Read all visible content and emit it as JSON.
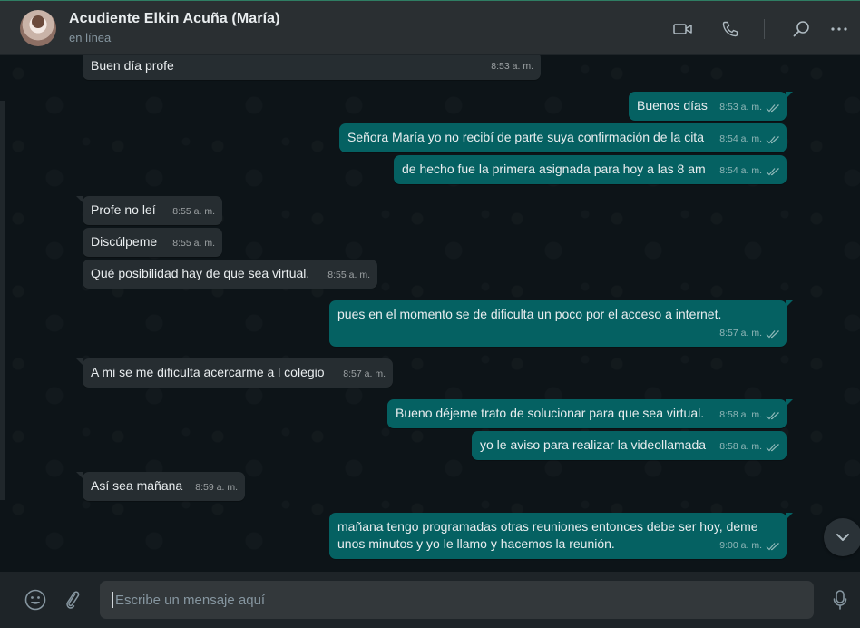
{
  "header": {
    "name": "Acudiente Elkin Acuña (María)",
    "status": "en línea"
  },
  "messages": [
    {
      "dir": "in",
      "text": "Buen día profe",
      "time": "8:53 a. m."
    },
    {
      "dir": "out",
      "text": "Buenos días",
      "time": "8:53 a. m."
    },
    {
      "dir": "out",
      "text": "Señora María yo no recibí de parte suya confirmación de la cita",
      "time": "8:54 a. m."
    },
    {
      "dir": "out",
      "text": "de hecho fue la primera asignada para hoy a las 8 am",
      "time": "8:54 a. m."
    },
    {
      "dir": "in",
      "text": "Profe no leí",
      "time": "8:55 a. m."
    },
    {
      "dir": "in",
      "text": "Discúlpeme",
      "time": "8:55 a. m."
    },
    {
      "dir": "in",
      "text": "Qué posibilidad hay de que sea virtual.",
      "time": "8:55 a. m."
    },
    {
      "dir": "out",
      "text": "pues en el momento se de dificulta un poco por el acceso a internet.",
      "time": "8:57 a. m."
    },
    {
      "dir": "in",
      "text": "A mi se me dificulta acercarme a l colegio",
      "time": "8:57 a. m."
    },
    {
      "dir": "out",
      "text": "Bueno déjeme trato de solucionar para que sea virtual.",
      "time": "8:58 a. m."
    },
    {
      "dir": "out",
      "text": "yo le aviso para realizar la videollamada",
      "time": "8:58 a. m."
    },
    {
      "dir": "in",
      "text": "Así sea mañana",
      "time": "8:59 a. m."
    },
    {
      "dir": "out",
      "text": "mañana tengo programadas otras reuniones entonces debe ser hoy, deme unos minutos y yo le llamo y hacemos la reunión.",
      "time": "9:00 a. m."
    }
  ],
  "composer": {
    "placeholder": "Escribe un mensaje aquí"
  },
  "icons": {
    "video": "video-camera-icon",
    "call": "phone-icon",
    "search": "search-icon",
    "menu": "more-icon",
    "emoji": "emoji-icon",
    "attach": "paperclip-icon",
    "mic": "microphone-icon",
    "scroll": "chevron-down-icon"
  },
  "colors": {
    "incoming_bubble": "#262d31",
    "outgoing_bubble": "#056162",
    "chat_background": "#0d1418",
    "header": "#2a2f32"
  }
}
